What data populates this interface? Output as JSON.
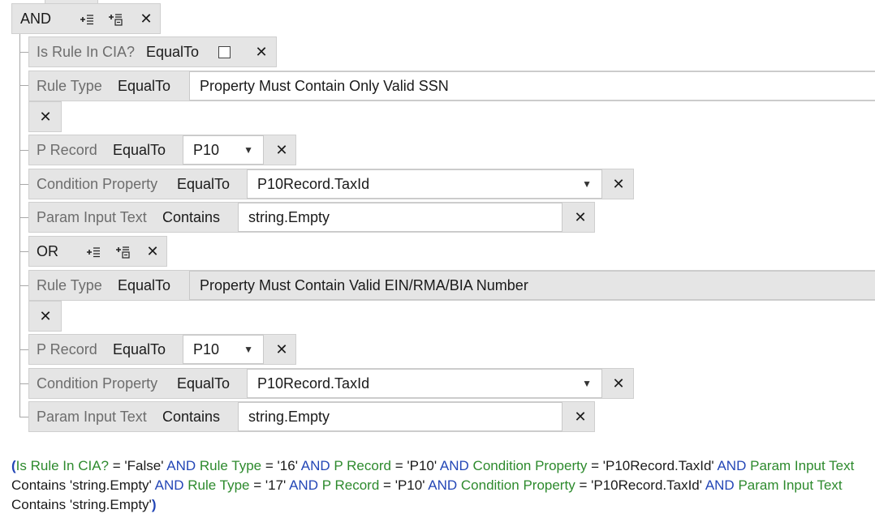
{
  "root": {
    "op_label": "AND"
  },
  "rows": [
    {
      "type": "bool",
      "label": "Is Rule In CIA?",
      "operator": "EqualTo"
    },
    {
      "type": "text",
      "label": "Rule Type",
      "operator": "EqualTo",
      "value": "Property Must Contain Only Valid SSN"
    },
    {
      "type": "dropdown",
      "label": "P Record",
      "operator": "EqualTo",
      "value": "P10"
    },
    {
      "type": "dropdown",
      "label": "Condition Property",
      "operator": "EqualTo",
      "value": "P10Record.TaxId"
    },
    {
      "type": "input",
      "label": "Param Input Text",
      "operator": "Contains",
      "value": "string.Empty"
    }
  ],
  "or_group": {
    "op_label": "OR",
    "rows": [
      {
        "type": "text",
        "label": "Rule Type",
        "operator": "EqualTo",
        "value": "Property Must Contain Valid EIN/RMA/BIA Number"
      },
      {
        "type": "dropdown",
        "label": "P Record",
        "operator": "EqualTo",
        "value": "P10"
      },
      {
        "type": "dropdown",
        "label": "Condition Property",
        "operator": "EqualTo",
        "value": "P10Record.TaxId"
      },
      {
        "type": "input",
        "label": "Param Input Text",
        "operator": "Contains",
        "value": "string.Empty"
      }
    ]
  },
  "glyphs": {
    "close": "✕",
    "dropdown_arrow": "▼"
  },
  "summary": {
    "open_paren": "(",
    "close_paren": ")",
    "and": "AND",
    "eq": "=",
    "contains": "Contains",
    "p1": "Is Rule In CIA?",
    "v1": "'False'",
    "p2": "Rule Type",
    "v2": "'16'",
    "p3": "P Record",
    "v3": "'P10'",
    "p4": "Condition Property",
    "v4": "'P10Record.TaxId'",
    "p5": "Param Input Text",
    "v5": "'string.Empty'",
    "p6": "Rule Type",
    "v6": "'17'",
    "p7": "P Record",
    "v7": "'P10'",
    "p8": "Condition Property",
    "v8": "'P10Record.TaxId'",
    "p9": "Param Input Text",
    "v9": "'string.Empty'"
  },
  "colors": {
    "keyword": "#2346b6",
    "property": "#2d8a2d",
    "panel": "#e5e5e5"
  }
}
